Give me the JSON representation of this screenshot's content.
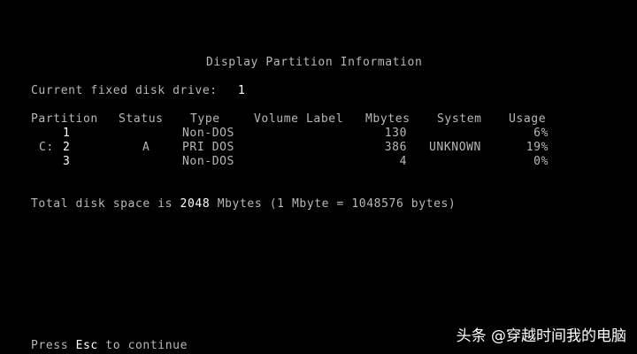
{
  "screen": {
    "title": "Display Partition Information",
    "drive_label": "Current fixed disk drive:",
    "drive_number": "1",
    "columns": [
      "Partition",
      "Status",
      "Type",
      "Volume Label",
      "Mbytes",
      "System",
      "Usage"
    ],
    "rows": [
      {
        "drive": "",
        "partition": "1",
        "status": "",
        "type": "Non-DOS",
        "volume_label": "",
        "mbytes": "130",
        "system": "",
        "usage": "6%"
      },
      {
        "drive": "C:",
        "partition": "2",
        "status": "A",
        "type": "PRI DOS",
        "volume_label": "",
        "mbytes": "386",
        "system": "UNKNOWN",
        "usage": "19%"
      },
      {
        "drive": "",
        "partition": "3",
        "status": "",
        "type": "Non-DOS",
        "volume_label": "",
        "mbytes": "4",
        "system": "",
        "usage": "0%"
      }
    ],
    "total_prefix": "Total disk space is",
    "total_value": "2048",
    "total_suffix": "Mbytes (1 Mbyte = 1048576 bytes)",
    "footer_prefix": "Press",
    "footer_key": "Esc",
    "footer_suffix": "to continue"
  },
  "watermark": {
    "text": "头条 @穿越时间我的电脑"
  },
  "colors": {
    "background": "#000000",
    "text": "#b8b8b8",
    "highlight": "#ffffff"
  }
}
